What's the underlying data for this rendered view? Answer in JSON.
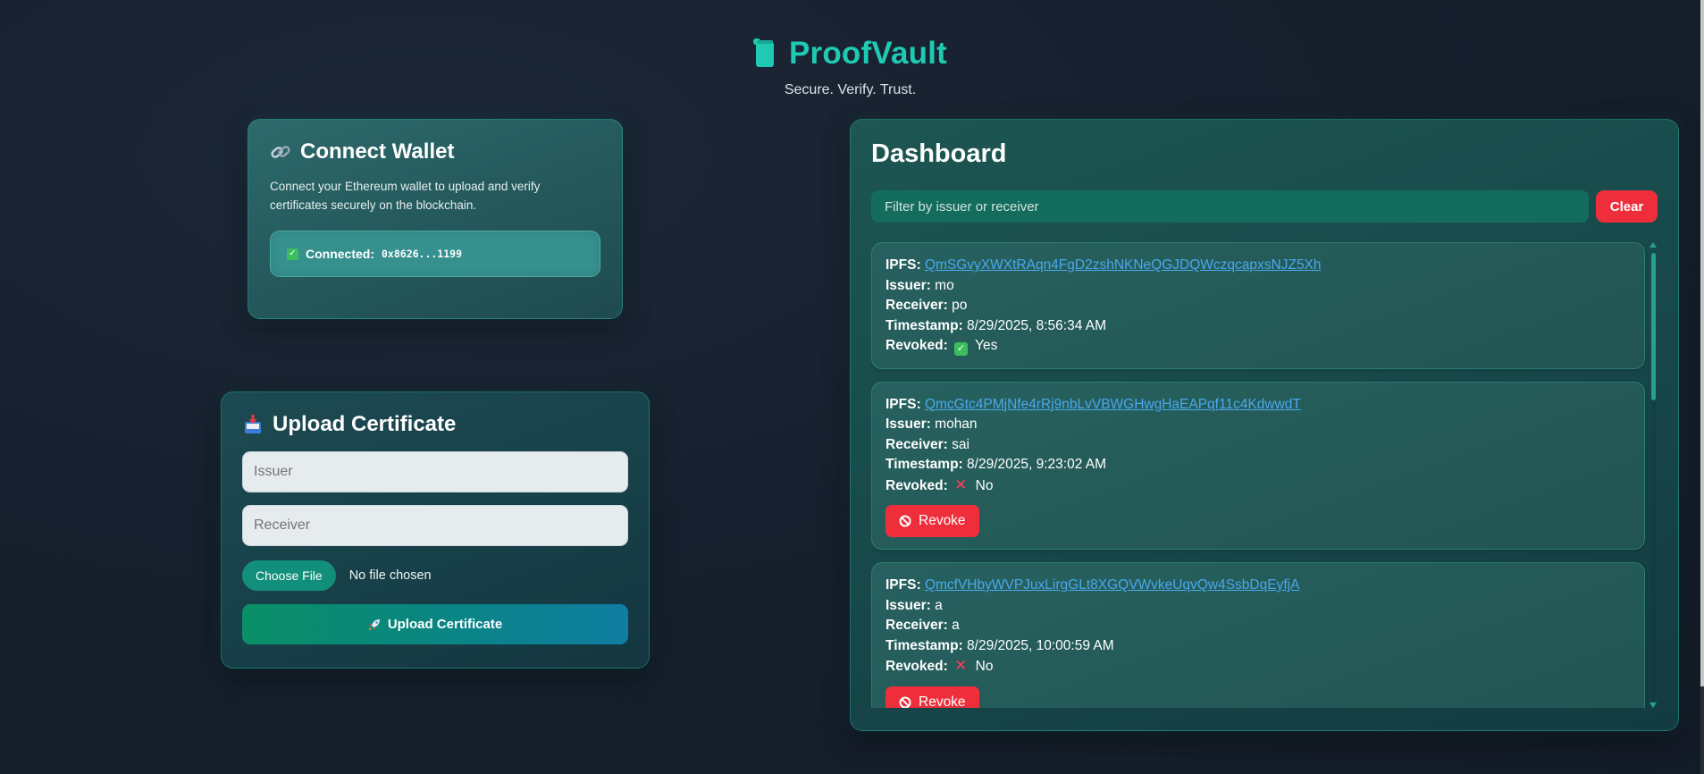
{
  "header": {
    "title": "ProofVault",
    "tagline": "Secure. Verify. Trust."
  },
  "wallet": {
    "title": "Connect Wallet",
    "description": "Connect your Ethereum wallet to upload and verify certificates securely on the blockchain.",
    "status_label": "Connected:",
    "address": "0x8626...1199"
  },
  "upload": {
    "title": "Upload Certificate",
    "issuer_placeholder": "Issuer",
    "receiver_placeholder": "Receiver",
    "choose_file_label": "Choose File",
    "file_status": "No file chosen",
    "submit_label": "Upload Certificate"
  },
  "dashboard": {
    "title": "Dashboard",
    "filter_placeholder": "Filter by issuer or receiver",
    "clear_label": "Clear",
    "labels": {
      "ipfs": "IPFS:",
      "issuer": "Issuer:",
      "receiver": "Receiver:",
      "timestamp": "Timestamp:",
      "revoked": "Revoked:"
    },
    "revoke_label": "Revoke",
    "records": [
      {
        "ipfs": "QmSGvyXWXtRAqn4FgD2zshNKNeQGJDQWczqcapxsNJZ5Xh",
        "issuer": "mo",
        "receiver": "po",
        "timestamp": "8/29/2025, 8:56:34 AM",
        "revoked": "Yes"
      },
      {
        "ipfs": "QmcGtc4PMjNfe4rRj9nbLvVBWGHwgHaEAPqf11c4KdwwdT",
        "issuer": "mohan",
        "receiver": "sai",
        "timestamp": "8/29/2025, 9:23:02 AM",
        "revoked": "No"
      },
      {
        "ipfs": "QmcfVHbyWVPJuxLirgGLt8XGQVWvkeUqvQw4SsbDqEyfjA",
        "issuer": "a",
        "receiver": "a",
        "timestamp": "8/29/2025, 10:00:59 AM",
        "revoked": "No"
      }
    ]
  },
  "colors": {
    "brand": "#1fc9b2",
    "danger": "#ee2f3b",
    "link": "#4aa8ec"
  }
}
